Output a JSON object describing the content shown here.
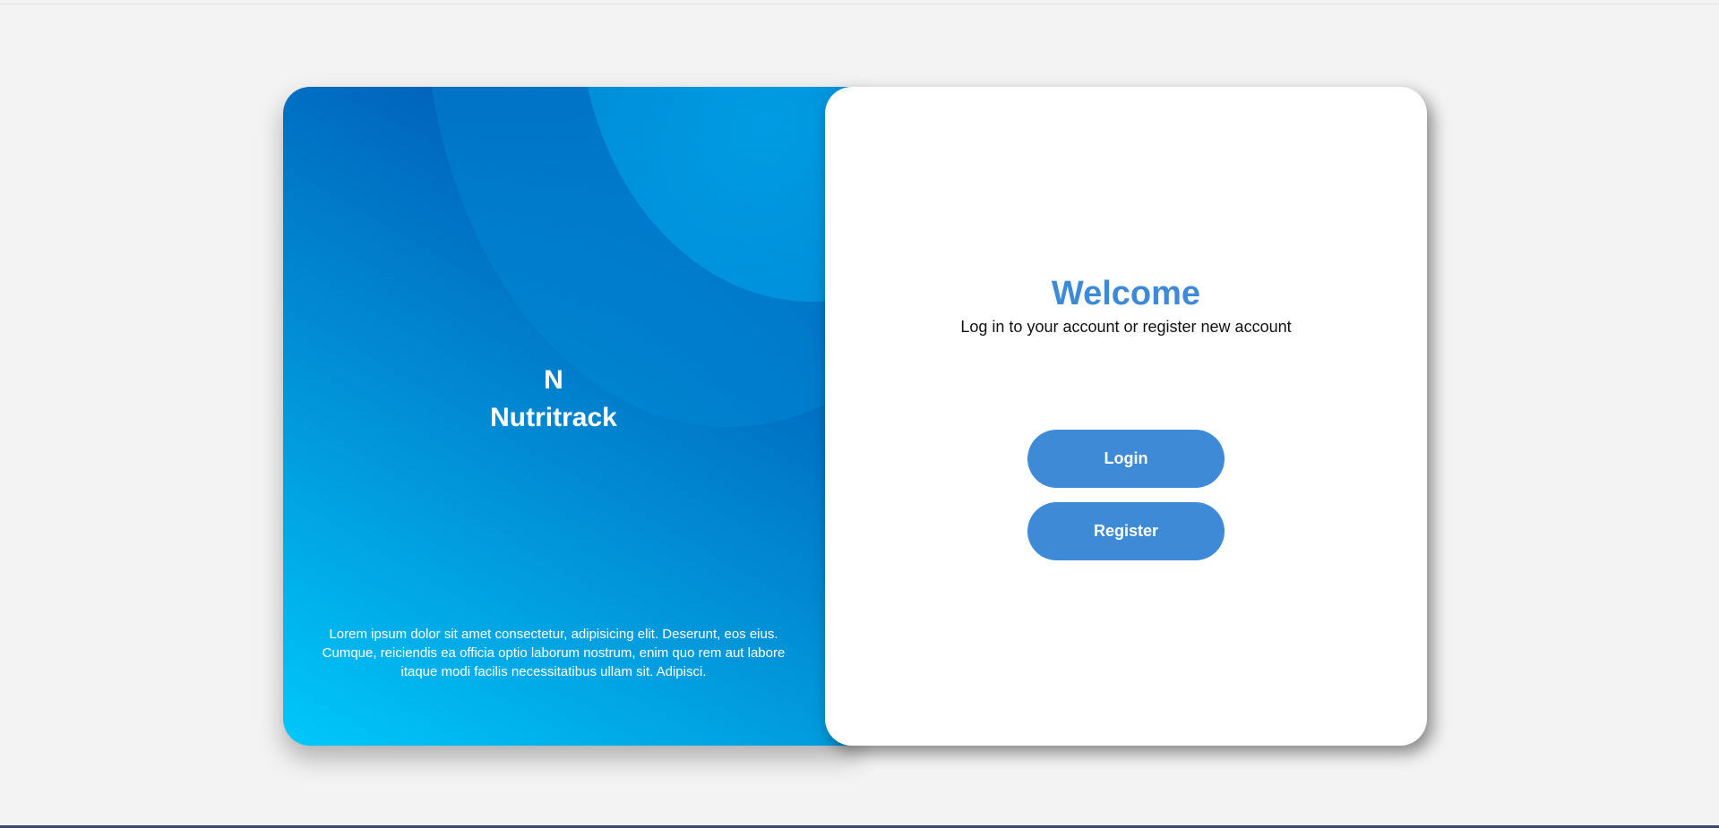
{
  "brand": {
    "logo_letter": "N",
    "name": "Nutritrack",
    "blurb": "Lorem ipsum dolor sit amet consectetur, adipisicing elit. Deserunt, eos eius. Cumque, reiciendis ea officia optio laborum nostrum, enim quo rem aut labore itaque modi facilis necessitatibus ullam sit. Adipisci."
  },
  "auth": {
    "title": "Welcome",
    "subtitle": "Log in to your account or register new account",
    "login_label": "Login",
    "register_label": "Register"
  },
  "colors": {
    "accent": "#3f8ad7",
    "title": "#3e8ad7",
    "gradient_light": "#00c8fa",
    "gradient_dark": "#0047a6",
    "background": "#f3f3f3"
  }
}
